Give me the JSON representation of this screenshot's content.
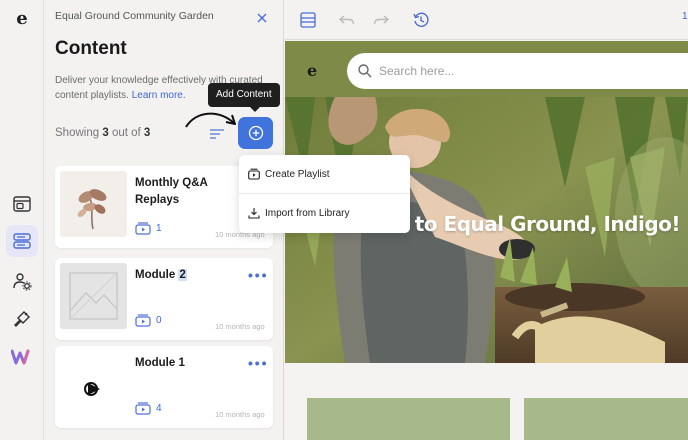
{
  "panel": {
    "org_name": "Equal Ground Community Garden",
    "title": "Content",
    "description": "Deliver your knowledge effectively with curated content playlists.",
    "learn_more": "Learn more.",
    "showing_prefix": "Showing",
    "showing_count": "3",
    "showing_mid": "out of",
    "showing_total": "3",
    "add_tooltip": "Add Content"
  },
  "cards": [
    {
      "title": "Monthly Q&A Replays",
      "count": "1",
      "date": "10 months ago"
    },
    {
      "title_main": "Module ",
      "title_sel": "2",
      "count": "0",
      "date": "10 months ago"
    },
    {
      "title": "Module 1",
      "count": "4",
      "date": "10 months ago"
    }
  ],
  "dropdown": {
    "items": [
      {
        "label": "Create Playlist",
        "icon": "playlist-icon"
      },
      {
        "label": "Import from Library",
        "icon": "download-icon"
      }
    ]
  },
  "toolbar": {
    "right_text": "1"
  },
  "preview": {
    "search_placeholder": "Search here...",
    "hero_text": "to Equal Ground, Indigo!"
  },
  "colors": {
    "accent": "#4073dc",
    "header_green": "#7e8b48",
    "tile_green": "#a7b98a",
    "brand_purple": "#7b5fd6"
  }
}
